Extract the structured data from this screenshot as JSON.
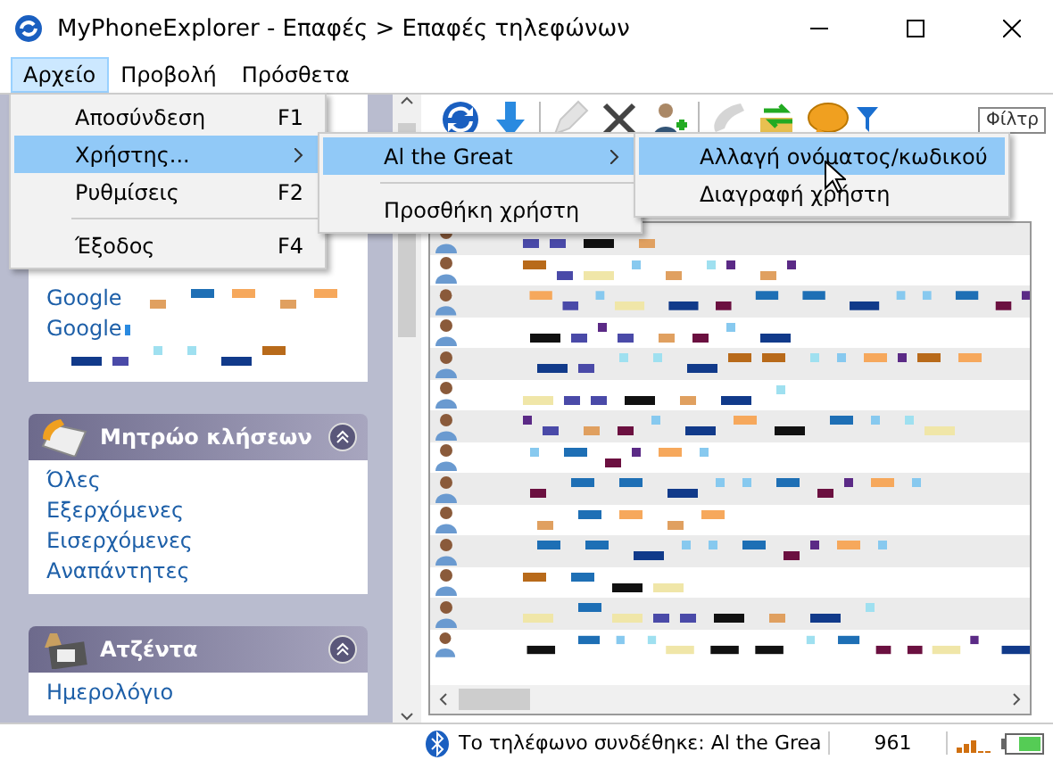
{
  "window": {
    "title": "MyPhoneExplorer -  Επαφές > Επαφές τηλεφώνων"
  },
  "menubar": [
    {
      "label": "Αρχείο",
      "selected": true
    },
    {
      "label": "Προβολή",
      "selected": false
    },
    {
      "label": "Πρόσθετα",
      "selected": false
    }
  ],
  "file_menu": [
    {
      "kind": "item",
      "label": "Αποσύνδεση",
      "shortcut": "F1",
      "selected": false
    },
    {
      "kind": "submenu",
      "label": "Χρήστης...",
      "selected": true
    },
    {
      "kind": "item",
      "label": "Ρυθμίσεις",
      "shortcut": "F2",
      "selected": false
    },
    {
      "kind": "separator"
    },
    {
      "kind": "item",
      "label": "Έξοδος",
      "shortcut": "F4",
      "selected": false
    }
  ],
  "user_menu": [
    {
      "kind": "submenu",
      "label": "Al the Great",
      "selected": true
    },
    {
      "kind": "separator"
    },
    {
      "kind": "item",
      "label": "Προσθήκη χρήστη",
      "selected": false
    }
  ],
  "user_actions_menu": [
    {
      "kind": "item",
      "label": "Αλλαγή ονόματος/κωδικού",
      "selected": true
    },
    {
      "kind": "item",
      "label": "Διαγραφή χρήστη",
      "selected": false
    }
  ],
  "toolbar": {
    "buttons": [
      {
        "kind": "refresh",
        "disabled": false
      },
      {
        "kind": "download",
        "disabled": false
      },
      {
        "kind": "separator"
      },
      {
        "kind": "edit",
        "disabled": true
      },
      {
        "kind": "delete",
        "disabled": false
      },
      {
        "kind": "add-contact",
        "disabled": false
      },
      {
        "kind": "separator"
      },
      {
        "kind": "call",
        "disabled": true
      },
      {
        "kind": "sync",
        "disabled": false
      },
      {
        "kind": "message",
        "disabled": false
      }
    ],
    "filter_label": "Φίλτρ"
  },
  "sidebar": {
    "links": [
      "Google",
      "Google"
    ],
    "sections": [
      {
        "title": "Μητρώο κλήσεων",
        "kind": "calls",
        "items": [
          "Όλες",
          "Εξερχόμενες",
          "Εισερχόμενες",
          "Αναπάντητες"
        ]
      },
      {
        "title": "Ατζέντα",
        "kind": "calendar",
        "items": [
          "Ημερολόγιο"
        ]
      }
    ]
  },
  "status_bar": {
    "message": "Το τηλέφωνο συνδέθηκε:  Al the Grea",
    "count": "961"
  }
}
